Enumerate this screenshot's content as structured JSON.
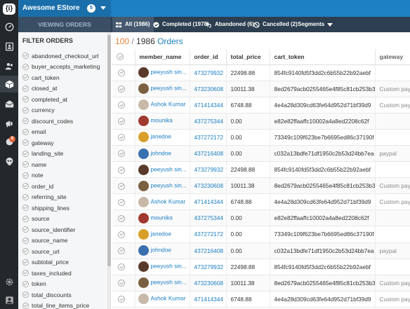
{
  "store": {
    "name": "Awesome EStore",
    "count": "5"
  },
  "sidebar_title": "VIEWING ORDERS",
  "tabs": [
    {
      "label": "All (1986)",
      "icon": "list-icon"
    },
    {
      "label": "Completed (1978)",
      "icon": "check-circle-icon"
    },
    {
      "label": "Abandoned (6)",
      "icon": "undo-icon"
    },
    {
      "label": "Cancelled (2)",
      "icon": "ban-icon"
    },
    {
      "label": "Segments",
      "icon": ""
    }
  ],
  "filters": {
    "title": "FILTER ORDERS",
    "items": [
      "abandoned_checkout_url",
      "buyer_accepts_marketing",
      "cart_token",
      "closed_at",
      "completed_at",
      "currency",
      "discount_codes",
      "email",
      "gateway",
      "landing_site",
      "name",
      "note",
      "order_id",
      "referring_site",
      "shipping_lines",
      "source",
      "source_identifier",
      "source_name",
      "source_url",
      "subtotal_price",
      "taxes_included",
      "token",
      "total_discounts",
      "total_line_items_price"
    ]
  },
  "counter": {
    "loaded": "100",
    "separator": " / ",
    "total": "1986",
    "word": " Orders"
  },
  "table": {
    "columns": [
      "member_name",
      "order_id",
      "total_price",
      "cart_token",
      "gateway"
    ],
    "rows": [
      {
        "member": "peeyush sin...",
        "order": "473279932",
        "price": "22498.88",
        "token": "854fc9140fd5f3dd2c6b55b22b92aebf",
        "gateway": "",
        "avatar": "#5a3a2a"
      },
      {
        "member": "peeyush sin...",
        "order": "473230608",
        "price": "10011.38",
        "token": "8ed2679acb0255465e4f85c81cb253b3d",
        "gateway": "Custom payme",
        "avatar": "#7a6040"
      },
      {
        "member": "Ashok Kumar",
        "order": "471414344",
        "price": "6748.88",
        "token": "4e4a28d309cd63fe64d952d71bf39d9",
        "gateway": "Custom payme",
        "avatar": "#c8b9a8"
      },
      {
        "member": "mounika",
        "order": "437275344",
        "price": "0.00",
        "token": "e82e82ffaaffc10002a4a8ed2208c62f",
        "gateway": "",
        "avatar": "#a0392f"
      },
      {
        "member": "janedoe",
        "order": "437272172",
        "price": "0.00",
        "token": "73349c109f623be7b6695ed86c37190f",
        "gateway": "",
        "avatar": "#d8a02a"
      },
      {
        "member": "johndoe",
        "order": "437216408",
        "price": "0.00",
        "token": "c032a13bdfe71df1950c2b53d24bb7ea",
        "gateway": "paypal",
        "avatar": "#3a6fb0"
      },
      {
        "member": "peeyush sin...",
        "order": "473279932",
        "price": "22498.88",
        "token": "854fc9140fd5f3dd2c6b55b22b92aebf",
        "gateway": "",
        "avatar": "#5a3a2a"
      },
      {
        "member": "peeyush sin...",
        "order": "473230608",
        "price": "10011.38",
        "token": "8ed2679acb0255465e4f85c81cb253b3d",
        "gateway": "Custom payme",
        "avatar": "#7a6040"
      },
      {
        "member": "Ashok Kumar",
        "order": "471414344",
        "price": "6748.88",
        "token": "4e4a28d309cd63fe64d952d71bf39d9",
        "gateway": "Custom payme",
        "avatar": "#c8b9a8"
      },
      {
        "member": "mounika",
        "order": "437275344",
        "price": "0.00",
        "token": "e82e82ffaaffc10002a4a8ed2208c62f",
        "gateway": "",
        "avatar": "#a0392f"
      },
      {
        "member": "janedoe",
        "order": "437272172",
        "price": "0.00",
        "token": "73349c109f623be7b6695ed86c37190f",
        "gateway": "",
        "avatar": "#d8a02a"
      },
      {
        "member": "johndoe",
        "order": "437216408",
        "price": "0.00",
        "token": "c032a13bdfe71df1950c2b53d24bb7ea",
        "gateway": "paypal",
        "avatar": "#3a6fb0"
      },
      {
        "member": "peeyush sin...",
        "order": "473279932",
        "price": "22498.88",
        "token": "854fc9140fd5f3dd2c6b55b22b92aebf",
        "gateway": "",
        "avatar": "#5a3a2a"
      },
      {
        "member": "peeyush sin...",
        "order": "473230608",
        "price": "10011.38",
        "token": "8ed2679acb0255465e4f85c81cb253b3d",
        "gateway": "Custom payme",
        "avatar": "#7a6040"
      },
      {
        "member": "Ashok Kumar",
        "order": "471414344",
        "price": "6748.88",
        "token": "4e4a28d309cd63fe64d952d71bf39d9",
        "gateway": "Custom payme",
        "avatar": "#c8b9a8"
      }
    ]
  },
  "colors": {
    "accent": "#1e80c4",
    "rail": "#23282d",
    "loaded": "#e8843a",
    "badge": "#e8643a"
  }
}
